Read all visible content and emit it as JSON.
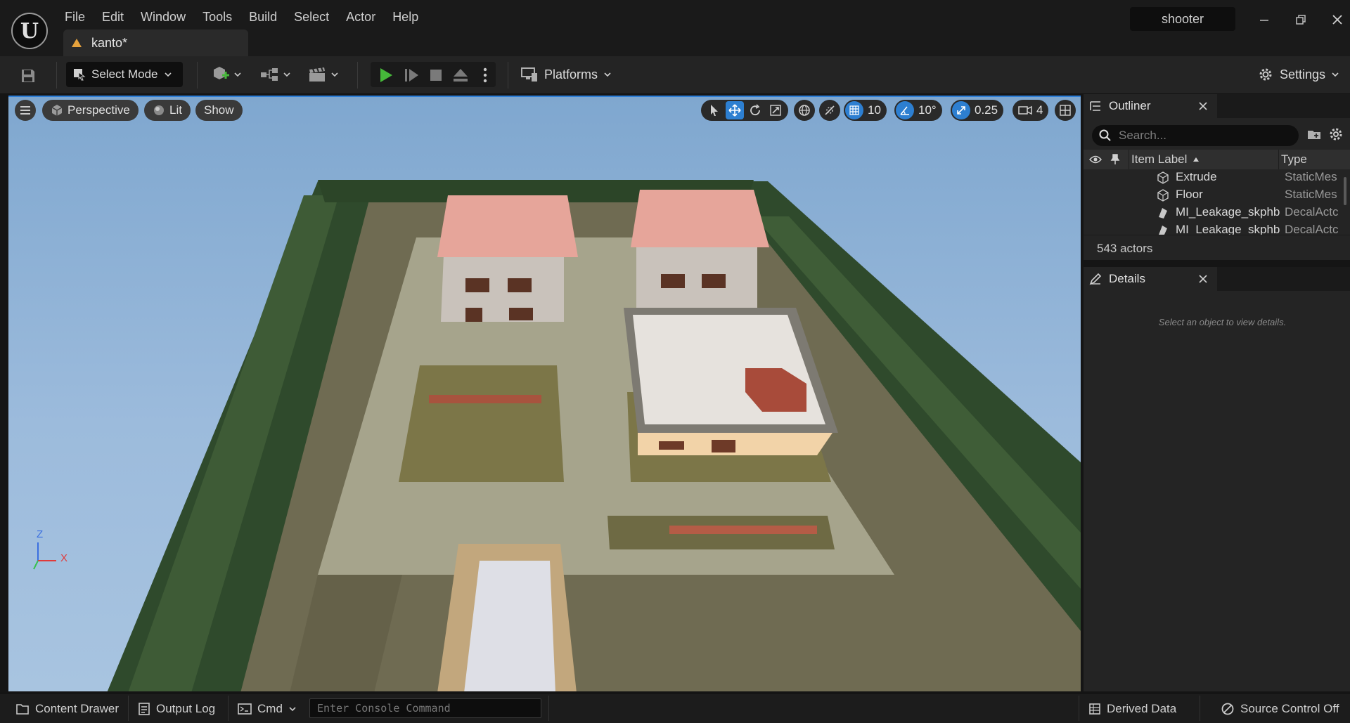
{
  "app": {
    "project_name": "shooter",
    "document_tab": "kanto*",
    "menu": [
      "File",
      "Edit",
      "Window",
      "Tools",
      "Build",
      "Select",
      "Actor",
      "Help"
    ]
  },
  "toolbar": {
    "select_mode_label": "Select Mode",
    "platforms_label": "Platforms",
    "settings_label": "Settings"
  },
  "viewport": {
    "perspective_label": "Perspective",
    "lit_label": "Lit",
    "show_label": "Show",
    "grid_snap_value": "10",
    "rotation_snap_value": "10°",
    "scale_snap_value": "0.25",
    "camera_speed_value": "4",
    "axis_z": "Z",
    "axis_x": "X"
  },
  "outliner": {
    "tab_label": "Outliner",
    "search_placeholder": "Search...",
    "col_label": "Item Label",
    "col_type": "Type",
    "rows": [
      {
        "label": "Extrude",
        "type": "StaticMes"
      },
      {
        "label": "Floor",
        "type": "StaticMes"
      },
      {
        "label": "MI_Leakage_skphb",
        "type": "DecalActc"
      },
      {
        "label": "MI_Leakage_skphb",
        "type": "DecalActc"
      }
    ],
    "actor_count": "543 actors"
  },
  "details": {
    "tab_label": "Details",
    "empty_message": "Select an object to view details."
  },
  "statusbar": {
    "content_drawer": "Content Drawer",
    "output_log": "Output Log",
    "cmd": "Cmd",
    "console_placeholder": "Enter Console Command",
    "derived_data": "Derived Data",
    "source_control": "Source Control Off"
  },
  "colors": {
    "accent": "#2d7fd1",
    "play_green": "#46b83a",
    "tab_icon": "#e6a23c"
  }
}
